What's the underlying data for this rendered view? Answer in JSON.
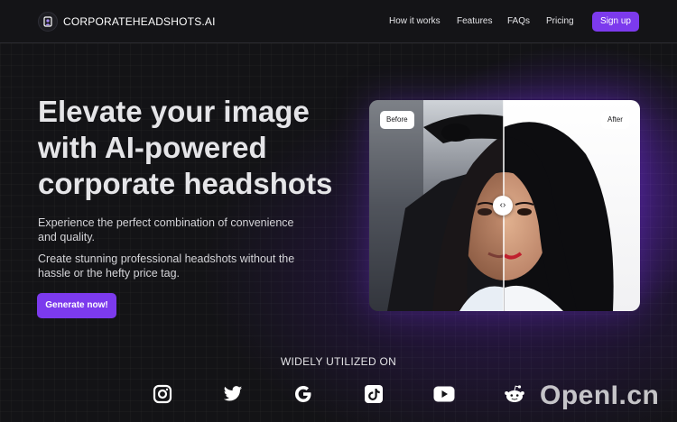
{
  "nav": {
    "brand": "CORPORATEHEADSHOTS.AI",
    "links": [
      "How it works",
      "Features",
      "FAQs",
      "Pricing"
    ],
    "signup_label": "Sign up"
  },
  "hero": {
    "headline_lines": [
      "Elevate your image",
      "with AI-powered",
      "corporate headshots"
    ],
    "paragraph1": "Experience the perfect combination of convenience and quality.",
    "paragraph2": "Create stunning professional headshots without the hassle or the hefty price tag.",
    "cta_label": "Generate now!"
  },
  "comparison": {
    "before_label": "Before",
    "after_label": "After",
    "handle_glyph": "‹›"
  },
  "platforms": {
    "heading": "WIDELY UTILIZED ON",
    "items": [
      "instagram-icon",
      "twitter-icon",
      "google-icon",
      "tiktok-icon",
      "youtube-icon",
      "reddit-icon"
    ]
  },
  "watermark": "OpenI.cn",
  "colors": {
    "accent": "#7c3aed",
    "background": "#131316",
    "text": "#ffffff"
  }
}
